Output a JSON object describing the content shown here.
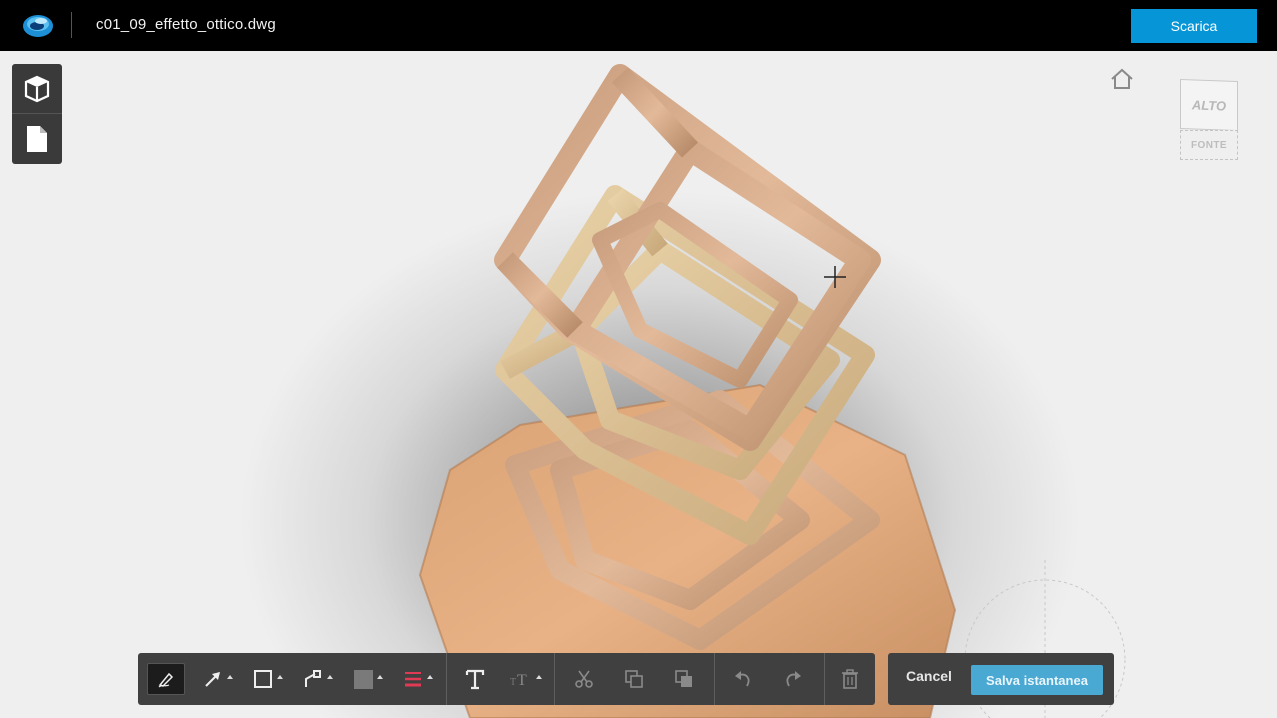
{
  "header": {
    "filename": "c01_09_effetto_ottico.dwg",
    "download_label": "Scarica",
    "logo_icon": "autodesk-viewer-logo-icon"
  },
  "side_panel": {
    "items": [
      {
        "icon": "model-cube-icon"
      },
      {
        "icon": "document-icon"
      }
    ]
  },
  "viewcube": {
    "top_label": "ALTO",
    "front_label": "FONTE"
  },
  "markup_toolbar": {
    "tools": [
      {
        "icon": "freehand-pen-icon",
        "active": true
      },
      {
        "icon": "arrow-icon"
      },
      {
        "icon": "rectangle-icon"
      },
      {
        "icon": "polyline-icon"
      },
      {
        "icon": "fill-color-icon"
      },
      {
        "icon": "stroke-width-icon"
      },
      {
        "icon": "text-icon"
      },
      {
        "icon": "text-size-icon"
      },
      {
        "icon": "cut-icon"
      },
      {
        "icon": "copy-icon"
      },
      {
        "icon": "paste-icon"
      },
      {
        "icon": "undo-icon"
      },
      {
        "icon": "redo-icon"
      },
      {
        "icon": "trash-icon"
      }
    ],
    "stroke_color": "#e03a54",
    "fill_color": "#7a7a7a"
  },
  "actions": {
    "cancel_label": "Cancel",
    "save_label": "Salva istantanea"
  },
  "colors": {
    "accent": "#0696d7",
    "save_button": "#4aa9d3",
    "toolbar_bg": "#404040"
  }
}
